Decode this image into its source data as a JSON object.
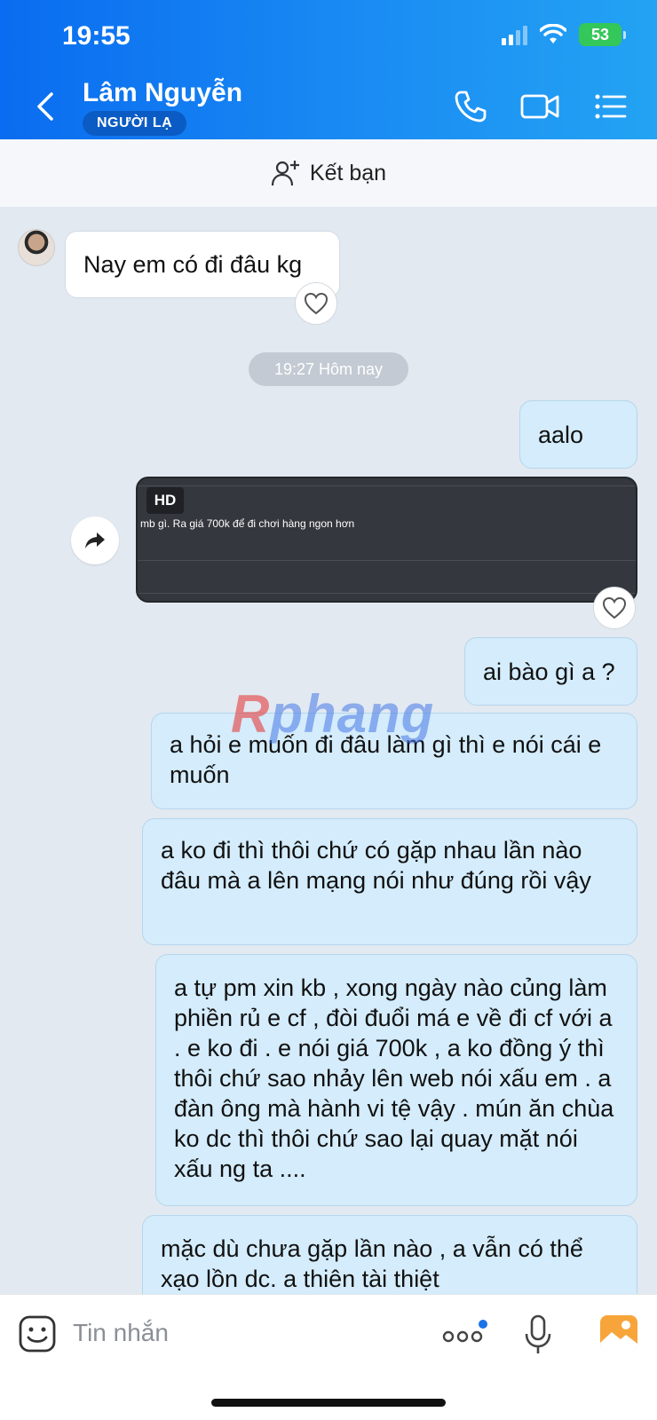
{
  "status_bar": {
    "time": "19:55",
    "battery": "53"
  },
  "header": {
    "contact_name": "Lâm Nguyễn",
    "badge": "NGƯỜI LẠ"
  },
  "add_friend": {
    "label": "Kết bạn"
  },
  "messages": {
    "m1": "Nay em có đi đâu kg",
    "timestamp": "19:27 Hôm nay",
    "m2": "aalo",
    "video": {
      "badge": "HD",
      "caption": "mb gì. Ra giá 700k để đi chơi hàng ngon hơn"
    },
    "m3": "ai bào gì a ?",
    "m4": "a hỏi e muốn đi đâu làm gì thì e nói cái e muốn",
    "m5": "a ko đi thì thôi chứ có gặp nhau lần nào đâu mà a lên mạng nói như đúng rồi vậy",
    "m6": "a tự pm xin kb , xong ngày nào củng làm phiền rủ e cf , đòi đuổi má e về đi cf với a . e ko đi . e nói giá 700k  , a ko đồng ý thì thôi chứ sao nhảy lên web nói xấu em . a đàn ông mà hành vi tệ vậy . mún ăn chùa ko dc thì thôi chứ sao lại quay mặt nói xấu ng ta ....",
    "m7": "mặc dù chưa gặp lần nào , a vẫn có thể xạo lồn dc. a thiên tài thiệt"
  },
  "watermark": {
    "r": "R",
    "rest": "phang"
  },
  "input": {
    "placeholder": "Tin nhắn"
  },
  "colors": {
    "header_blue": "#0a6cf0",
    "outgoing_bubble": "#d4ecfb",
    "accent_orange": "#f7a53a"
  }
}
